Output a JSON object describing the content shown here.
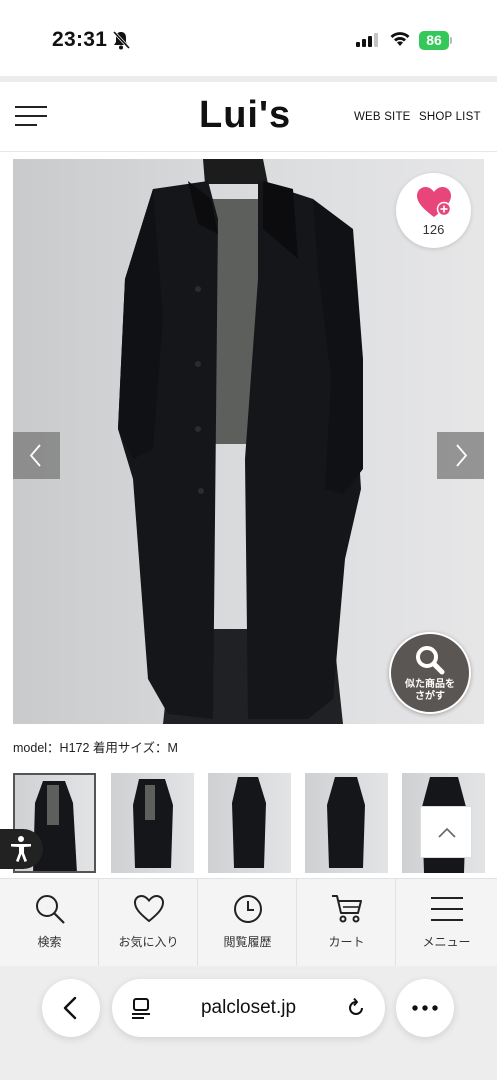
{
  "status_bar": {
    "time": "23:31",
    "battery": "86"
  },
  "header": {
    "brand": "Lui's",
    "nav": [
      "WEB SITE",
      "SHOP LIST"
    ]
  },
  "product": {
    "favorite_count": "126",
    "similar_search_label": "似た商品を\nさがす",
    "model_caption": "model：H172 着用サイズ：M",
    "thumbnail_count": 5,
    "selected_thumbnail_index": 0
  },
  "bottom_nav": [
    {
      "label": "検索",
      "icon": "search-icon"
    },
    {
      "label": "お気に入り",
      "icon": "heart-icon"
    },
    {
      "label": "閲覧履歴",
      "icon": "clock-icon"
    },
    {
      "label": "カート",
      "icon": "cart-icon"
    },
    {
      "label": "メニュー",
      "icon": "menu-icon"
    }
  ],
  "browser": {
    "url": "palcloset.jp"
  },
  "colors": {
    "accent_pink": "#e8457a",
    "battery_green": "#34c759",
    "coat": "#15161a"
  }
}
